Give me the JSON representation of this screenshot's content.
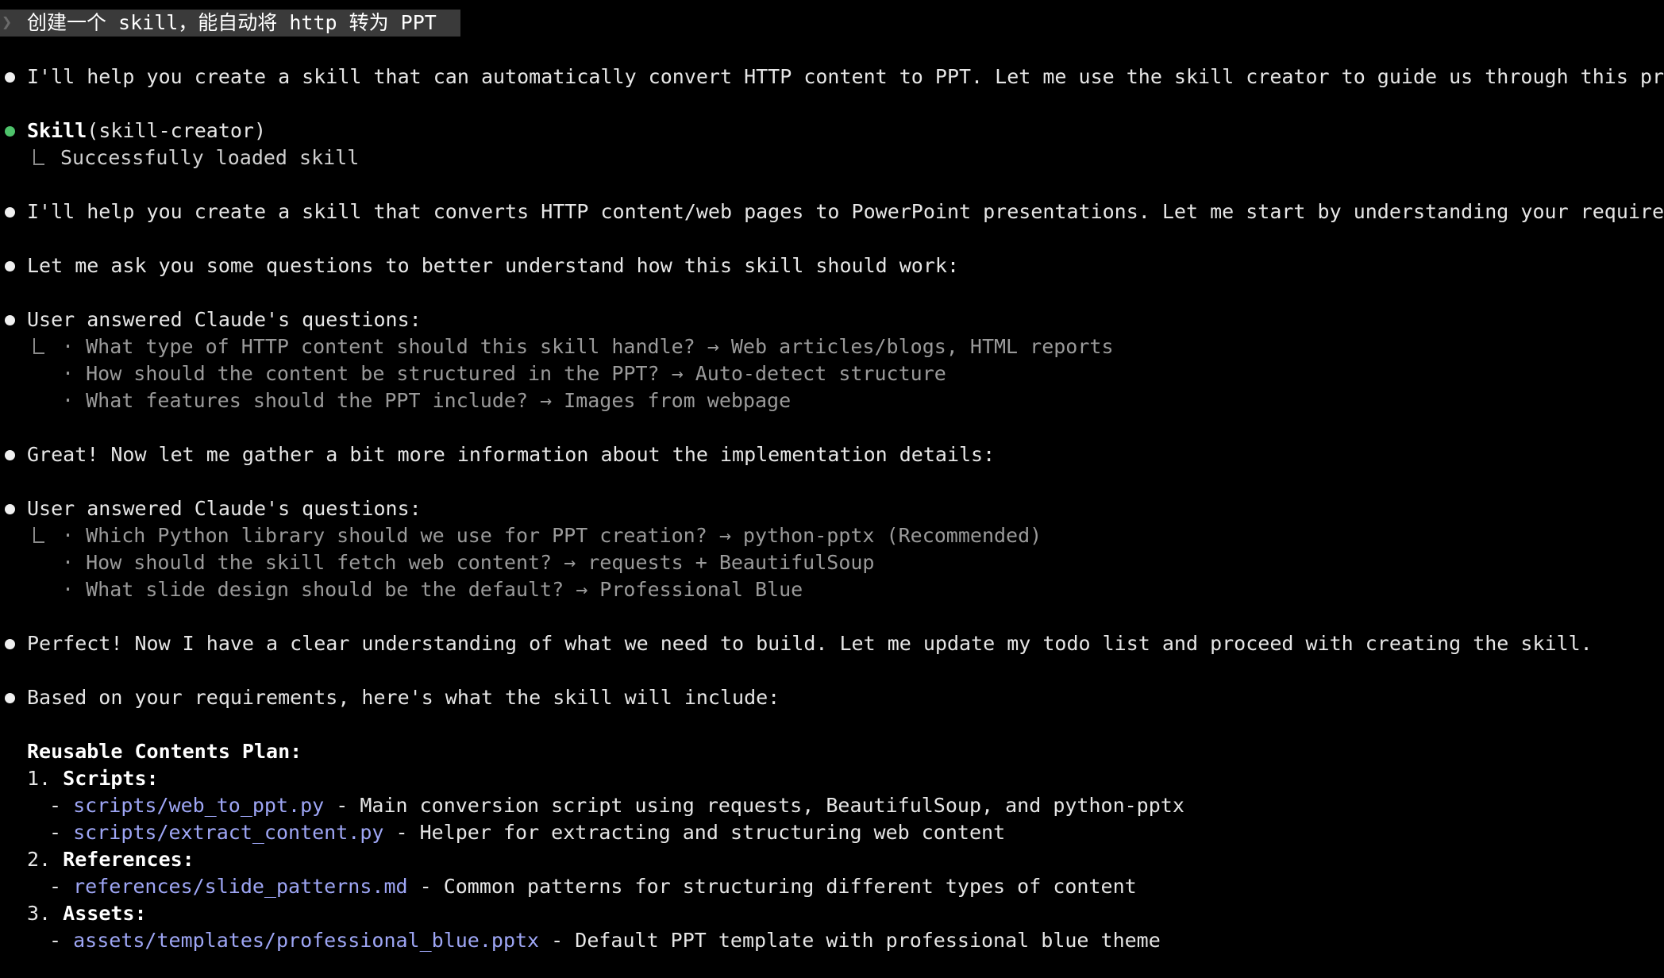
{
  "prompt": {
    "text": "创建一个 skill，能自动将 http 转为 PPT"
  },
  "messages": {
    "m1": "I'll help you create a skill that can automatically convert HTTP content to PPT. Let me use the skill creator to guide us through this process.",
    "tool": {
      "name": "Skill",
      "arg": "(skill-creator)",
      "result": "Successfully loaded skill"
    },
    "m2": "I'll help you create a skill that converts HTTP content/web pages to PowerPoint presentations. Let me start by understanding your requirements bette",
    "m3": "Let me ask you some questions to better understand how this skill should work:",
    "qa1": {
      "header": "User answered Claude's questions:",
      "items": [
        "· What type of HTTP content should this skill handle? → Web articles/blogs, HTML reports",
        "· How should the content be structured in the PPT? → Auto-detect structure",
        "· What features should the PPT include? → Images from webpage"
      ]
    },
    "m4": "Great! Now let me gather a bit more information about the implementation details:",
    "qa2": {
      "header": "User answered Claude's questions:",
      "items": [
        "· Which Python library should we use for PPT creation? → python-pptx (Recommended)",
        "· How should the skill fetch web content? → requests + BeautifulSoup",
        "· What slide design should be the default? → Professional Blue"
      ]
    },
    "m5": "Perfect! Now I have a clear understanding of what we need to build. Let me update my todo list and proceed with creating the skill.",
    "m6": "Based on your requirements, here's what the skill will include:"
  },
  "plan": {
    "title": "Reusable Contents Plan:",
    "sections": [
      {
        "number": "1.",
        "label": "Scripts:",
        "items": [
          {
            "path": "scripts/web_to_ppt.py",
            "desc": " - Main conversion script using requests, BeautifulSoup, and python-pptx"
          },
          {
            "path": "scripts/extract_content.py",
            "desc": " - Helper for extracting and structuring web content"
          }
        ]
      },
      {
        "number": "2.",
        "label": "References:",
        "items": [
          {
            "path": "references/slide_patterns.md",
            "desc": " - Common patterns for structuring different types of content"
          }
        ]
      },
      {
        "number": "3.",
        "label": "Assets:",
        "items": [
          {
            "path": "assets/templates/professional_blue.pptx",
            "desc": " - Default PPT template with professional blue theme"
          }
        ]
      }
    ]
  },
  "colors": {
    "background": "#000000",
    "text": "#e6e6e6",
    "dim": "#9a9a9a",
    "link": "#9ea6f5",
    "tool_bullet": "#4ec36b"
  }
}
